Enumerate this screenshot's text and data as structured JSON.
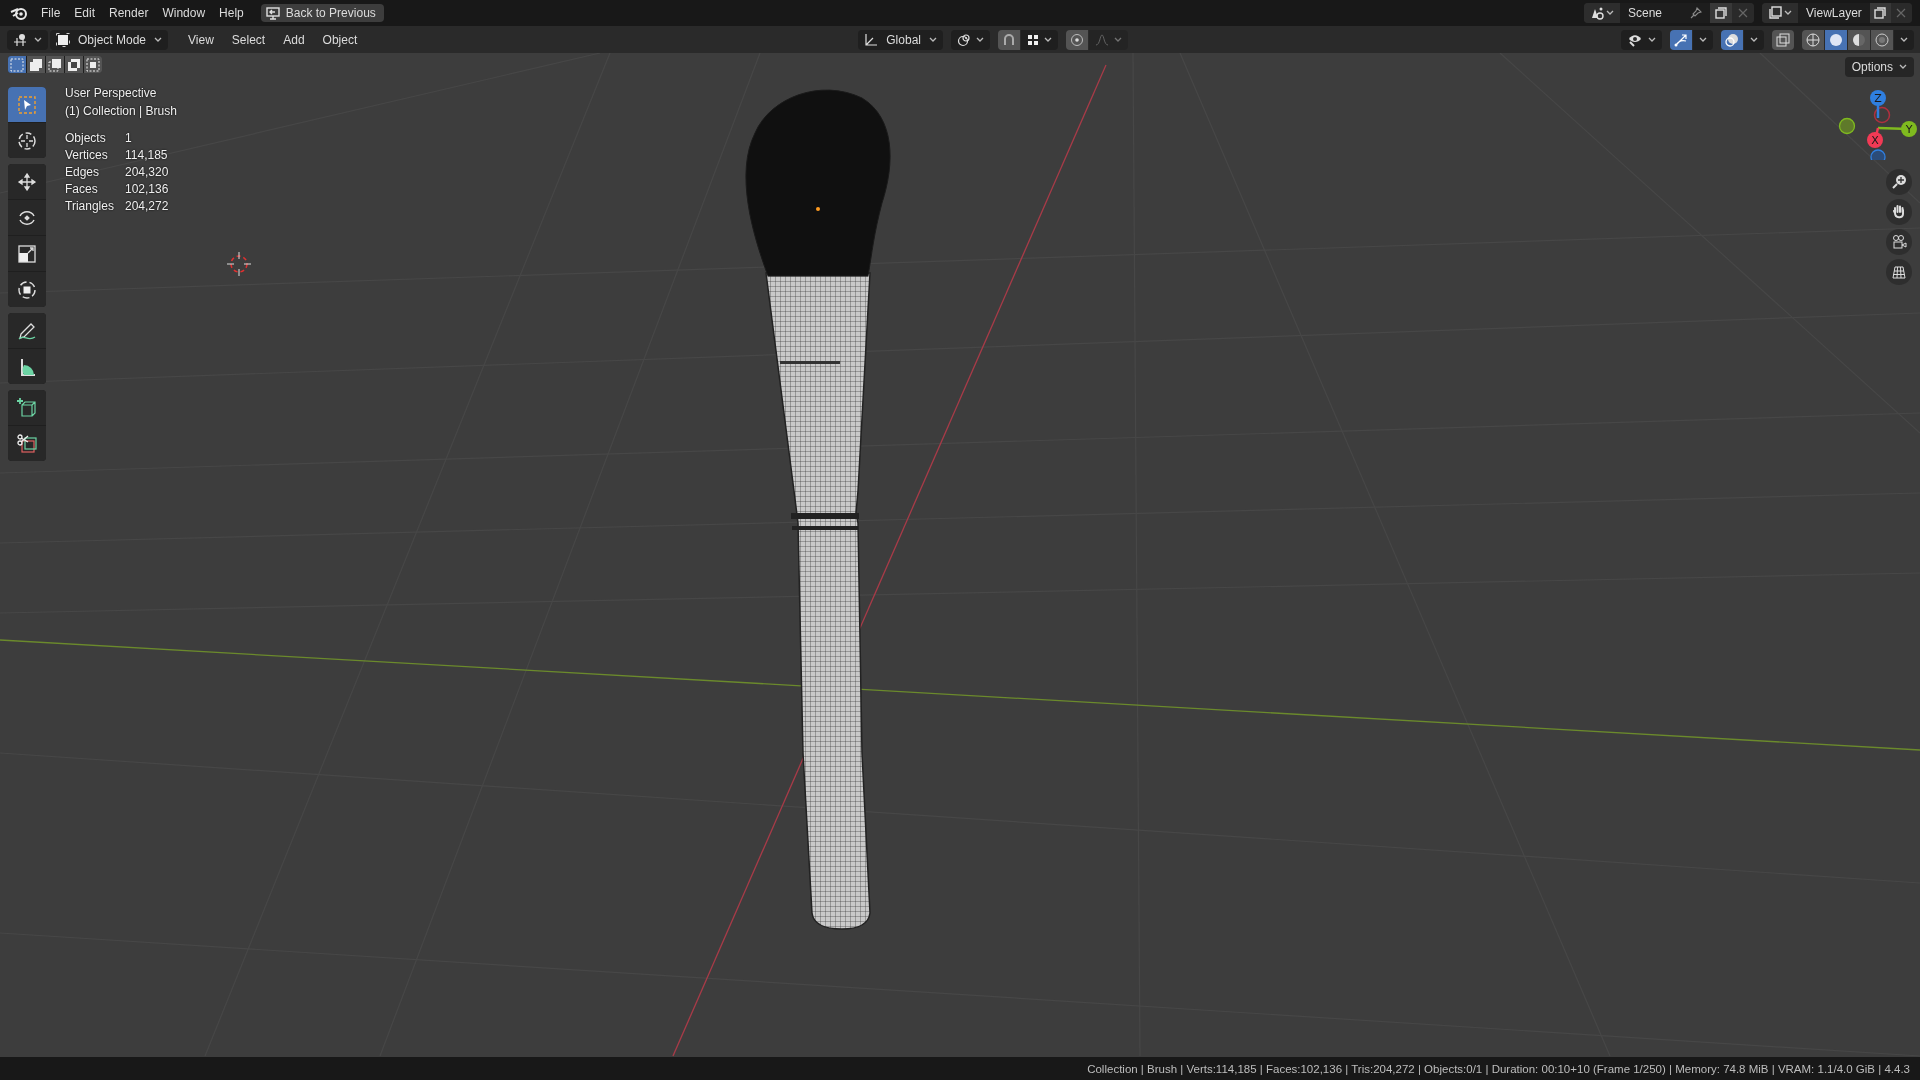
{
  "top_bar": {
    "menus": [
      "File",
      "Edit",
      "Render",
      "Window",
      "Help"
    ],
    "back_button": "Back to Previous",
    "scene": "Scene",
    "view_layer": "ViewLayer"
  },
  "header": {
    "mode": "Object Mode",
    "menus": [
      "View",
      "Select",
      "Add",
      "Object"
    ],
    "orientation": "Global",
    "snap_on": false,
    "proportional_on": false,
    "gizmos_on": true,
    "overlays_on": true,
    "xray_on": false,
    "shading": [
      {
        "kind": "wireframe",
        "selected": false
      },
      {
        "kind": "solid",
        "selected": true
      },
      {
        "kind": "material",
        "selected": false
      },
      {
        "kind": "rendered",
        "selected": false
      }
    ]
  },
  "select_modes": [
    {
      "kind": "set",
      "selected": true
    },
    {
      "kind": "extend",
      "selected": false
    },
    {
      "kind": "subtract",
      "selected": false
    },
    {
      "kind": "difference",
      "selected": false
    },
    {
      "kind": "intersect",
      "selected": false
    }
  ],
  "options_button": "Options",
  "tool_groups": [
    [
      {
        "kind": "select",
        "selected": true
      },
      {
        "kind": "cursor",
        "selected": false
      }
    ],
    [
      {
        "kind": "move",
        "selected": false
      },
      {
        "kind": "rotate",
        "selected": false
      },
      {
        "kind": "scale",
        "selected": false
      },
      {
        "kind": "transform",
        "selected": false
      }
    ],
    [
      {
        "kind": "annotate",
        "selected": false
      },
      {
        "kind": "measure",
        "selected": false
      }
    ],
    [
      {
        "kind": "add_cube",
        "selected": false
      },
      {
        "kind": "cut",
        "selected": false
      }
    ]
  ],
  "viewport": {
    "view_name": "User Perspective",
    "collection": "(1) Collection | Brush",
    "stats": [
      {
        "label": "Objects",
        "value": "1"
      },
      {
        "label": "Vertices",
        "value": "114,185"
      },
      {
        "label": "Edges",
        "value": "204,320"
      },
      {
        "label": "Faces",
        "value": "102,136"
      },
      {
        "label": "Triangles",
        "value": "204,272"
      }
    ]
  },
  "gizmo": {
    "axes": [
      {
        "kind": "z",
        "label": "Z",
        "color": "#2f7fe0"
      },
      {
        "kind": "y",
        "label": "Y",
        "color": "#7fba1f"
      },
      {
        "kind": "x",
        "label": "X",
        "color": "#f23a55"
      }
    ]
  },
  "status_bar": {
    "info": "Collection | Brush | Verts:114,185 | Faces:102,136 | Tris:204,272 | Objects:0/1 | Duration: 00:10+10 (Frame 1/250) | Memory: 74.8 MiB | VRAM: 1.1/4.0 GiB | 4.4.3"
  }
}
